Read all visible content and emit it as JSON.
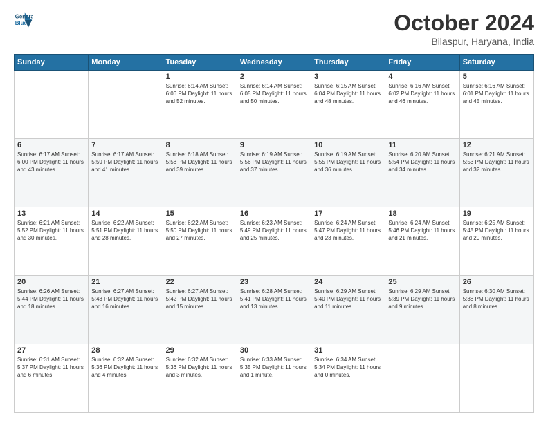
{
  "header": {
    "logo_line1": "General",
    "logo_line2": "Blue",
    "month_title": "October 2024",
    "location": "Bilaspur, Haryana, India"
  },
  "weekdays": [
    "Sunday",
    "Monday",
    "Tuesday",
    "Wednesday",
    "Thursday",
    "Friday",
    "Saturday"
  ],
  "weeks": [
    [
      {
        "day": "",
        "info": ""
      },
      {
        "day": "",
        "info": ""
      },
      {
        "day": "1",
        "info": "Sunrise: 6:14 AM\nSunset: 6:06 PM\nDaylight: 11 hours\nand 52 minutes."
      },
      {
        "day": "2",
        "info": "Sunrise: 6:14 AM\nSunset: 6:05 PM\nDaylight: 11 hours\nand 50 minutes."
      },
      {
        "day": "3",
        "info": "Sunrise: 6:15 AM\nSunset: 6:04 PM\nDaylight: 11 hours\nand 48 minutes."
      },
      {
        "day": "4",
        "info": "Sunrise: 6:16 AM\nSunset: 6:02 PM\nDaylight: 11 hours\nand 46 minutes."
      },
      {
        "day": "5",
        "info": "Sunrise: 6:16 AM\nSunset: 6:01 PM\nDaylight: 11 hours\nand 45 minutes."
      }
    ],
    [
      {
        "day": "6",
        "info": "Sunrise: 6:17 AM\nSunset: 6:00 PM\nDaylight: 11 hours\nand 43 minutes."
      },
      {
        "day": "7",
        "info": "Sunrise: 6:17 AM\nSunset: 5:59 PM\nDaylight: 11 hours\nand 41 minutes."
      },
      {
        "day": "8",
        "info": "Sunrise: 6:18 AM\nSunset: 5:58 PM\nDaylight: 11 hours\nand 39 minutes."
      },
      {
        "day": "9",
        "info": "Sunrise: 6:19 AM\nSunset: 5:56 PM\nDaylight: 11 hours\nand 37 minutes."
      },
      {
        "day": "10",
        "info": "Sunrise: 6:19 AM\nSunset: 5:55 PM\nDaylight: 11 hours\nand 36 minutes."
      },
      {
        "day": "11",
        "info": "Sunrise: 6:20 AM\nSunset: 5:54 PM\nDaylight: 11 hours\nand 34 minutes."
      },
      {
        "day": "12",
        "info": "Sunrise: 6:21 AM\nSunset: 5:53 PM\nDaylight: 11 hours\nand 32 minutes."
      }
    ],
    [
      {
        "day": "13",
        "info": "Sunrise: 6:21 AM\nSunset: 5:52 PM\nDaylight: 11 hours\nand 30 minutes."
      },
      {
        "day": "14",
        "info": "Sunrise: 6:22 AM\nSunset: 5:51 PM\nDaylight: 11 hours\nand 28 minutes."
      },
      {
        "day": "15",
        "info": "Sunrise: 6:22 AM\nSunset: 5:50 PM\nDaylight: 11 hours\nand 27 minutes."
      },
      {
        "day": "16",
        "info": "Sunrise: 6:23 AM\nSunset: 5:49 PM\nDaylight: 11 hours\nand 25 minutes."
      },
      {
        "day": "17",
        "info": "Sunrise: 6:24 AM\nSunset: 5:47 PM\nDaylight: 11 hours\nand 23 minutes."
      },
      {
        "day": "18",
        "info": "Sunrise: 6:24 AM\nSunset: 5:46 PM\nDaylight: 11 hours\nand 21 minutes."
      },
      {
        "day": "19",
        "info": "Sunrise: 6:25 AM\nSunset: 5:45 PM\nDaylight: 11 hours\nand 20 minutes."
      }
    ],
    [
      {
        "day": "20",
        "info": "Sunrise: 6:26 AM\nSunset: 5:44 PM\nDaylight: 11 hours\nand 18 minutes."
      },
      {
        "day": "21",
        "info": "Sunrise: 6:27 AM\nSunset: 5:43 PM\nDaylight: 11 hours\nand 16 minutes."
      },
      {
        "day": "22",
        "info": "Sunrise: 6:27 AM\nSunset: 5:42 PM\nDaylight: 11 hours\nand 15 minutes."
      },
      {
        "day": "23",
        "info": "Sunrise: 6:28 AM\nSunset: 5:41 PM\nDaylight: 11 hours\nand 13 minutes."
      },
      {
        "day": "24",
        "info": "Sunrise: 6:29 AM\nSunset: 5:40 PM\nDaylight: 11 hours\nand 11 minutes."
      },
      {
        "day": "25",
        "info": "Sunrise: 6:29 AM\nSunset: 5:39 PM\nDaylight: 11 hours\nand 9 minutes."
      },
      {
        "day": "26",
        "info": "Sunrise: 6:30 AM\nSunset: 5:38 PM\nDaylight: 11 hours\nand 8 minutes."
      }
    ],
    [
      {
        "day": "27",
        "info": "Sunrise: 6:31 AM\nSunset: 5:37 PM\nDaylight: 11 hours\nand 6 minutes."
      },
      {
        "day": "28",
        "info": "Sunrise: 6:32 AM\nSunset: 5:36 PM\nDaylight: 11 hours\nand 4 minutes."
      },
      {
        "day": "29",
        "info": "Sunrise: 6:32 AM\nSunset: 5:36 PM\nDaylight: 11 hours\nand 3 minutes."
      },
      {
        "day": "30",
        "info": "Sunrise: 6:33 AM\nSunset: 5:35 PM\nDaylight: 11 hours\nand 1 minute."
      },
      {
        "day": "31",
        "info": "Sunrise: 6:34 AM\nSunset: 5:34 PM\nDaylight: 11 hours\nand 0 minutes."
      },
      {
        "day": "",
        "info": ""
      },
      {
        "day": "",
        "info": ""
      }
    ]
  ]
}
